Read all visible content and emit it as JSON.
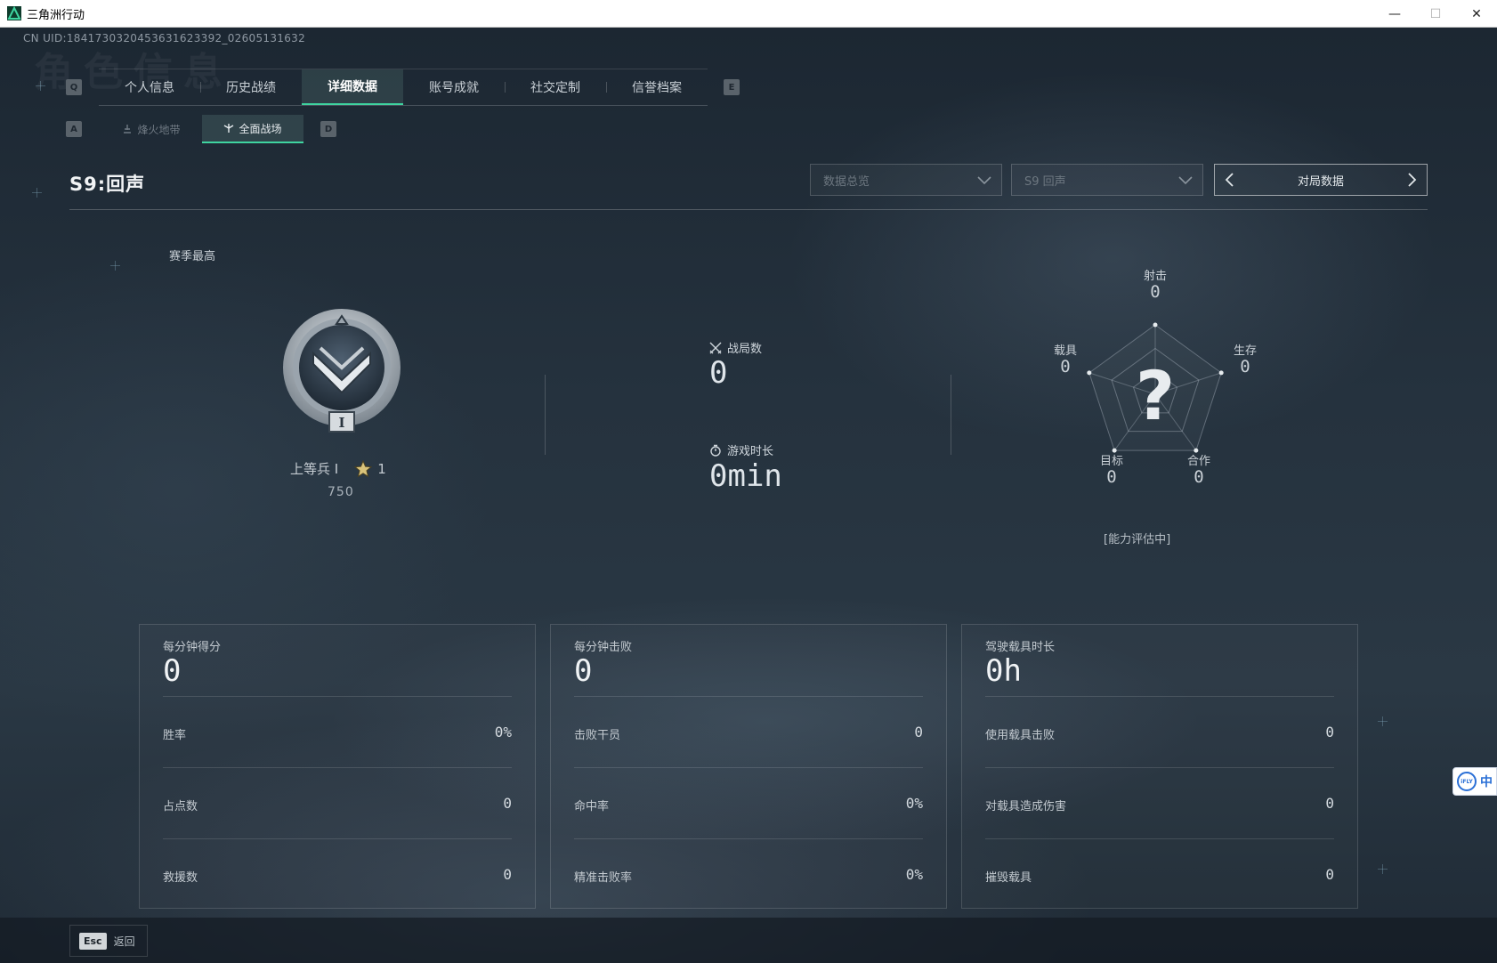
{
  "window": {
    "title": "三角洲行动",
    "minimize": "—",
    "restore": "☐",
    "close": "✕"
  },
  "uid": "CN UID:1841730320453631623392_02605131632",
  "bg_word": "角色信息",
  "keys": {
    "prev_tab": "Q",
    "next_tab": "E",
    "prev_sub": "A",
    "next_sub": "D"
  },
  "main_tabs": [
    {
      "label": "个人信息",
      "active": false
    },
    {
      "label": "历史战绩",
      "active": false
    },
    {
      "label": "详细数据",
      "active": true
    },
    {
      "label": "账号成就",
      "active": false
    },
    {
      "label": "社交定制",
      "active": false
    },
    {
      "label": "信誉档案",
      "active": false
    }
  ],
  "sub_tabs": [
    {
      "label": "烽火地带",
      "icon": "flame-zone-icon",
      "active": false
    },
    {
      "label": "全面战场",
      "icon": "battlefield-icon",
      "active": true
    }
  ],
  "season_title": "S9:回声",
  "filters": {
    "data_view": "数据总览",
    "season": "S9 回声",
    "match_mode": "对局数据"
  },
  "rank": {
    "section_label": "赛季最高",
    "name": "上等兵 I",
    "stars": "1",
    "score": "750",
    "tier_numeral": "I"
  },
  "summary": {
    "matches_label": "战局数",
    "matches_value": "0",
    "playtime_label": "游戏时长",
    "playtime_value": "0min"
  },
  "radar": {
    "center": "?",
    "axes": [
      {
        "label": "射击",
        "value": "0"
      },
      {
        "label": "生存",
        "value": "0"
      },
      {
        "label": "合作",
        "value": "0"
      },
      {
        "label": "目标",
        "value": "0"
      },
      {
        "label": "载具",
        "value": "0"
      }
    ],
    "note": "[能力评估中]"
  },
  "panels": [
    {
      "title": "每分钟得分",
      "value": "0",
      "rows": [
        {
          "label": "胜率",
          "value": "0%"
        },
        {
          "label": "占点数",
          "value": "0"
        },
        {
          "label": "救援数",
          "value": "0"
        }
      ]
    },
    {
      "title": "每分钟击败",
      "value": "0",
      "rows": [
        {
          "label": "击败干员",
          "value": "0"
        },
        {
          "label": "命中率",
          "value": "0%"
        },
        {
          "label": "精准击败率",
          "value": "0%"
        }
      ]
    },
    {
      "title": "驾驶载具时长",
      "value": "0h",
      "rows": [
        {
          "label": "使用载具击败",
          "value": "0"
        },
        {
          "label": "对载具造成伤害",
          "value": "0"
        },
        {
          "label": "摧毁载具",
          "value": "0"
        }
      ]
    }
  ],
  "bottom": {
    "esc_key": "Esc",
    "back_label": "返回"
  },
  "ime": {
    "label": "中",
    "logo": "iFLY"
  },
  "colors": {
    "accent": "#3fd4a0",
    "background": "#1b2530"
  }
}
